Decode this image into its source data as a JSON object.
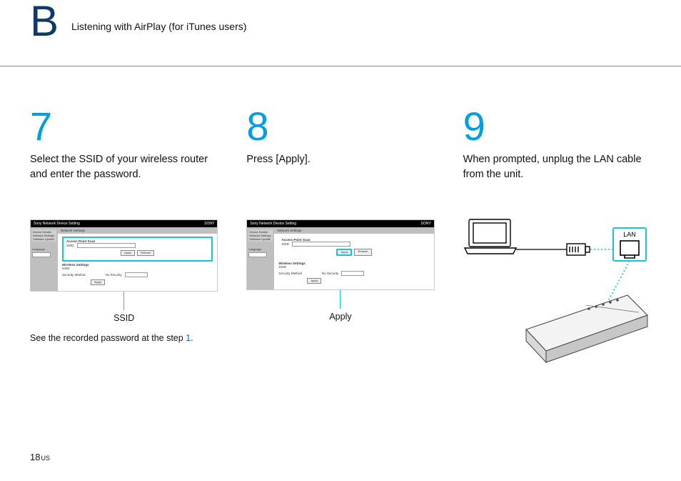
{
  "header": {
    "section_letter": "B",
    "section_title": "Listening with AirPlay (for iTunes users)"
  },
  "steps": [
    {
      "number": "7",
      "text": "Select the SSID of your wireless router and enter the password.",
      "callout_label": "SSID",
      "note_prefix": "See the recorded password at the step ",
      "note_link": "1",
      "note_suffix": "."
    },
    {
      "number": "8",
      "text": "Press [Apply].",
      "callout_label": "Apply"
    },
    {
      "number": "9",
      "text": "When prompted, unplug the LAN cable from the unit.",
      "lan_label": "LAN"
    }
  ],
  "mock_ui": {
    "window_title": "Sony Network Device Setting",
    "brand": "SONY",
    "sidebar": {
      "items": [
        "Device Details",
        "Network Settings",
        "Software Update"
      ],
      "language_label": "Language"
    },
    "tab_title": "Network Settings",
    "section1_title": "Access Point Scan",
    "section1_field_label": "SSID",
    "btn_apply": "Apply",
    "btn_refresh": "Refresh",
    "section2_title": "Wireless Settings",
    "section2_field_ssid": "SSID",
    "section2_field_method": "Security Method"
  },
  "footer": {
    "page_number": "18",
    "region": "US"
  }
}
